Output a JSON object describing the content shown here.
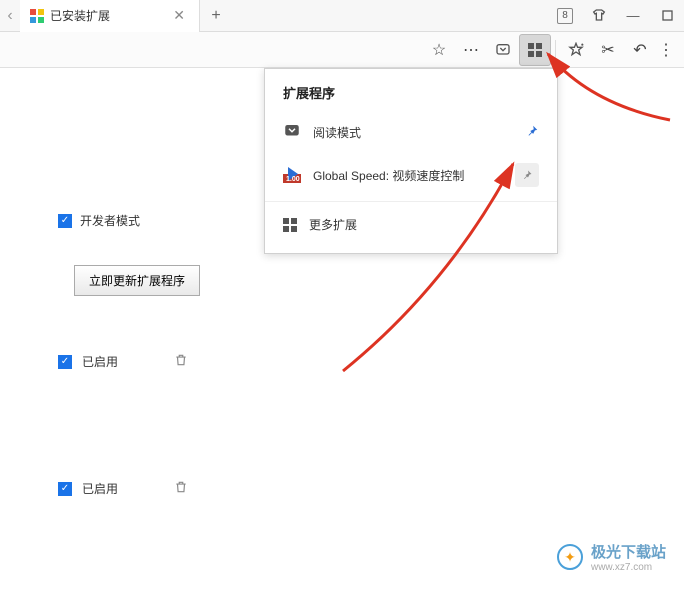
{
  "titlebar": {
    "tab_title": "已安装扩展",
    "badge": "8"
  },
  "popup": {
    "title": "扩展程序",
    "reading_mode": "阅读模式",
    "global_speed": "Global Speed: 视频速度控制",
    "more": "更多扩展"
  },
  "left": {
    "dev_mode": "开发者模式",
    "update_btn": "立即更新扩展程序",
    "enabled": "已启用"
  },
  "watermark": {
    "text": "极光下载站",
    "url": "www.xz7.com"
  }
}
